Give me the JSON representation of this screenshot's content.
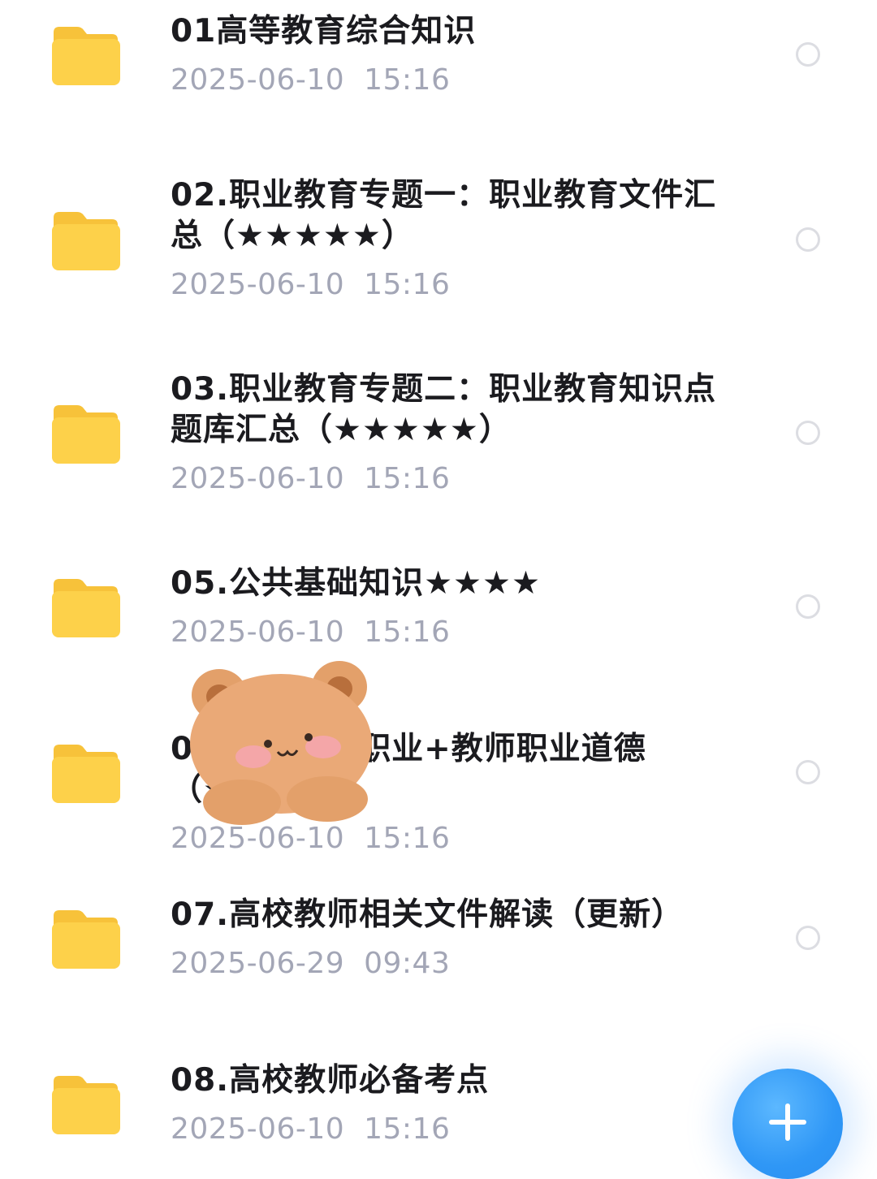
{
  "colors": {
    "folder": "#fdd14a",
    "folder_tab": "#f7c23a",
    "title": "#1b1b1f",
    "date": "#a3a6b6",
    "radio_border": "#dcdde2",
    "fab": "#2f97f6"
  },
  "files": [
    {
      "title": "01高等教育综合知识",
      "date": "2025-06-10  15:16"
    },
    {
      "title": "02.职业教育专题一：职业教育文件汇总（★★★★★）",
      "date": "2025-06-10  15:16"
    },
    {
      "title": "03.职业教育专题二：职业教育知识点题库汇总（★★★★★）",
      "date": "2025-06-10  15:16"
    },
    {
      "title": "05.公共基础知识★★★★",
      "date": "2025-06-10  15:16"
    },
    {
      "title": "06.高校教师职业+教师职业道德（★★★）",
      "date": "2025-06-10  15:16"
    },
    {
      "title": "07.高校教师相关文件解读（更新）",
      "date": "2025-06-29  09:43"
    },
    {
      "title": "08.高校教师必备考点",
      "date": "2025-06-10  15:16"
    }
  ],
  "fab": {
    "icon": "plus-icon"
  },
  "sticker": {
    "icon": "teddy-bear-sticker"
  },
  "item_icons": {
    "folder": "folder-icon",
    "select": "radio-circle-icon"
  }
}
